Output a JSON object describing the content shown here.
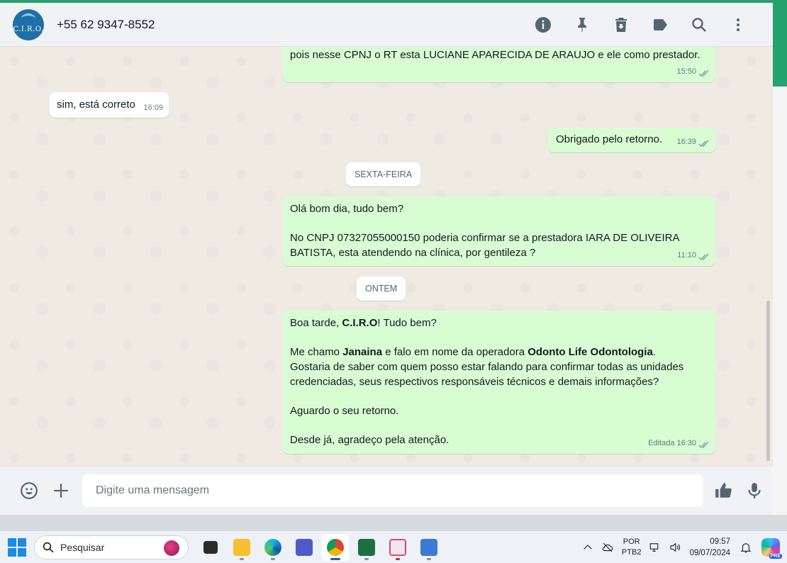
{
  "header": {
    "avatar_text": "C.I.R.O.",
    "contact": "+55 62 9347-8552",
    "icons": [
      "info-icon",
      "pin-icon",
      "delete-icon",
      "label-icon",
      "search-icon",
      "menu-icon"
    ]
  },
  "messages": [
    {
      "dir": "out",
      "text": "pois nesse CPNJ o RT esta LUCIANE APARECIDA DE ARAUJO e ele como prestador.",
      "time": "15:50"
    },
    {
      "dir": "in",
      "text": "sim, está correto",
      "time": "16:09"
    },
    {
      "dir": "out",
      "text": "Obrigado pelo retorno.",
      "time": "16:39"
    },
    {
      "dir": "out",
      "line1": "Olá bom dia, tudo bem?",
      "line2": "No CNPJ 07327055000150 poderia confirmar se a prestadora IARA DE OLIVEIRA BATISTA, esta atendendo na clínica, por gentileza ?",
      "time": "11:10"
    },
    {
      "dir": "out",
      "p1_a": "Boa tarde, ",
      "p1_b": "C.I.R.O",
      "p1_c": "! Tudo bem?",
      "p2_a": "Me chamo ",
      "p2_b": "Janaina",
      "p2_c": " e falo em nome da operadora ",
      "p2_d": "Odonto Life Odontologia",
      "p2_e": ".",
      "p2_f": "Gostaria de saber com quem posso estar falando para confirmar todas as unidades credenciadas, seus respectivos responsáveis técnicos e demais informações?",
      "p3": "Aguardo o seu retorno.",
      "p4": "Desde já, agradeço pela atenção.",
      "edited": "Editada",
      "time": "16:30"
    }
  ],
  "day_chips": [
    "SEXTA-FEIRA",
    "ONTEM"
  ],
  "compose": {
    "placeholder": "Digite uma mensagem"
  },
  "taskbar": {
    "search_label": "Pesquisar",
    "lang_1": "POR",
    "lang_2": "PTB2",
    "time": "09:57",
    "date": "09/07/2024",
    "copilot_badge": "PRE"
  }
}
